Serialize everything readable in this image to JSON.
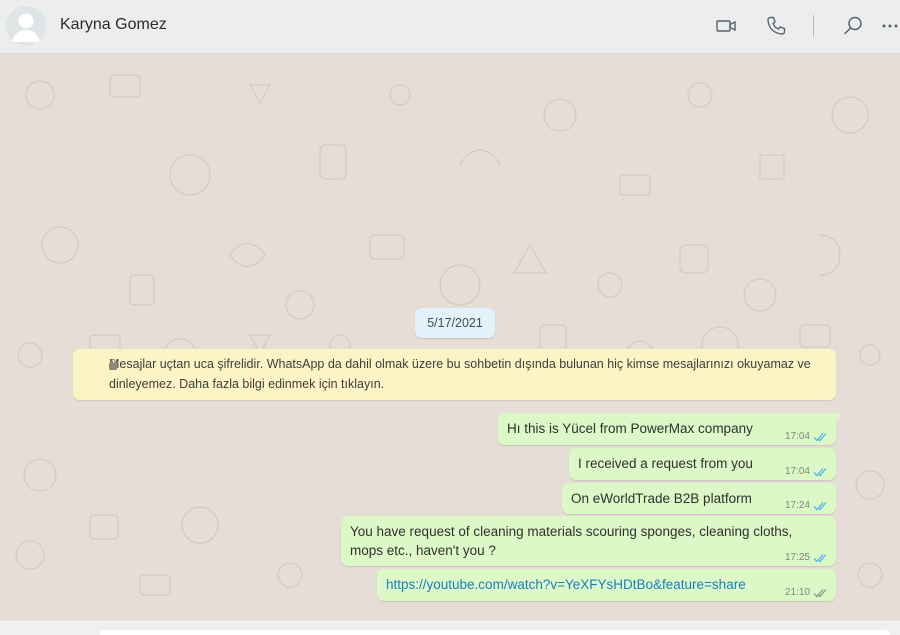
{
  "header": {
    "contact_name": "Karyna Gomez",
    "icons": [
      "video-call-icon",
      "voice-call-icon",
      "search-icon",
      "more-options-icon"
    ]
  },
  "chat": {
    "date_chip": "5/17/2021",
    "encryption_notice": "Mesajlar uçtan uca şifrelidir. WhatsApp da dahil olmak üzere bu sohbetin dışında bulunan hiç kimse mesajlarınızı okuyamaz ve dinleyemez. Daha fazla bilgi edinmek için tıklayın.",
    "messages": [
      {
        "text": "Hı this is Yücel from PowerMax company",
        "time": "17:04",
        "status": "read"
      },
      {
        "text": "I received a request from you",
        "time": "17:04",
        "status": "read"
      },
      {
        "text": "On eWorldTrade B2B platform",
        "time": "17:24",
        "status": "read"
      },
      {
        "text": "You have request of cleaning materials scouring sponges, cleaning cloths, mops etc., haven't you ?",
        "time": "17:25",
        "status": "read"
      },
      {
        "text": "https://youtube.com/watch?v=YeXFYsHDtBo&feature=share",
        "time": "21:10",
        "status": "delivered",
        "is_link": true
      }
    ]
  },
  "colors": {
    "outgoing_bubble": "#dcf8c6",
    "chat_background": "#e6ded6",
    "notice_background": "#fcf4c4",
    "date_chip_background": "#e1f2fb",
    "read_tick": "#4fb6ec",
    "link": "#1a7fc1"
  }
}
